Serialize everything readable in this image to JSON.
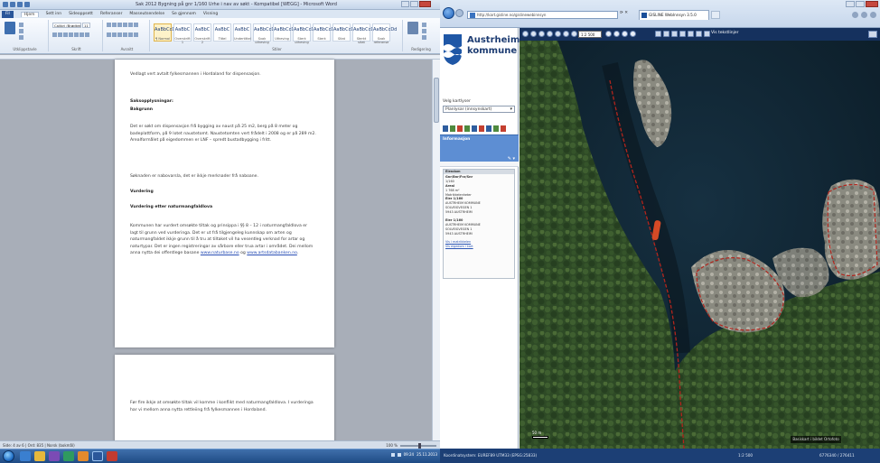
{
  "word": {
    "title": "Sak 2012 Bygning på gnr 1/160 Urhe i nav av søkt - Kompatibel [WEGG] - Microsoft Word",
    "ribbon_tabs": [
      "Fil",
      "Hjem",
      "Sett inn",
      "Sideoppsett",
      "Referanser",
      "Masseutsendelse",
      "Se gjennom",
      "Visning"
    ],
    "file_tab": "Fil",
    "active_tab": "Hjem",
    "font_name": "Calibri (Brødtekst)",
    "font_size": "11",
    "styles": [
      {
        "sample": "AaBbCcDd",
        "name": "¶ Normal"
      },
      {
        "sample": "AaBbC",
        "name": "Overskrift 1"
      },
      {
        "sample": "AaBbC",
        "name": "Overskrift 2"
      },
      {
        "sample": "AaBbC",
        "name": "Tittel"
      },
      {
        "sample": "AaBbC",
        "name": "Undertittel"
      },
      {
        "sample": "AaBbCcDd",
        "name": "Svak utheving"
      },
      {
        "sample": "AaBbCcDd",
        "name": "Utheving"
      },
      {
        "sample": "AaBbCcDd",
        "name": "Sterk utheving"
      },
      {
        "sample": "AaBbCcDd",
        "name": "Sterk"
      },
      {
        "sample": "AaBbCcDd",
        "name": "Sitat"
      },
      {
        "sample": "AaBbCcDd",
        "name": "Sterkt sitat"
      },
      {
        "sample": "AaBbCcDd",
        "name": "Svak referanse"
      }
    ],
    "group_labels": [
      "Utklippstavle",
      "Skrift",
      "Avsnitt",
      "Stiler",
      "Redigering"
    ],
    "page1": {
      "line1": "Vedlagt vert avtalt fylkesmannen i Hordaland for dispensasjon.",
      "h1": "Saksopplysningar:",
      "h2": "Bakgrunn",
      "p1": "Det er søkt om dispensasjon frå bygging av naust på 25 m2, berg på 8 meter og badeplattform, på 9 lotet naustetomt. Naustetomten vert frådelt i 2008 og er på 289 m2. Arealformålet på eigedommen er LNF – spredt bustadbygging i fritt.",
      "p2": "Søknaden er nabovarsla, det er ikkje merknader frå naboane.",
      "h3": "Vurdering",
      "h4": "Vurdering etter naturmangfaldlova",
      "p3": "Kommunen har vurdert omsøkte tiltak og prinsippa i §§ 8 – 12 i naturmangfaldlova er lagt til grunn ved vurderinga. Det er ut frå tilgjengeleg kunnskap om arten og naturmangfaldet ikkje grunn til å tru at tiltaket vil ha vesentleg verknad for artar og naturtypar. Det er ingen registreringar av sårbare eller trua artar i området. Dei mellom anna nytta dei offentlege basane ",
      "link1": "www.naturbase.no",
      "and": " og ",
      "link2": "www.artsdatabanken.no",
      "end": "."
    },
    "page2": {
      "p1": "Før fire ikkje at omsøkte tiltak vil komme i konflikt med naturmangfaldlova. I vurderinga har vi mellom anna nytta rettleiing frå fylkesmannen i Hordaland."
    },
    "status_left": "Side: 4 av 6   |   Ord: 835   |   Norsk (bokmål)",
    "zoom": "100 %"
  },
  "browser": {
    "address": "http://kart.gisline.no/gislinewebinnsyn",
    "tab_title": "GISLINE WebInnsyn 3.5.0",
    "logo_text": "Austrheim\nkommune",
    "panel": {
      "choose_label": "Velg kartlyser",
      "choose_value": "Planlysar (innsynskart)",
      "section_title": "Informasjon",
      "info_header": "Eiendom",
      "info_lines": [
        "Gnr/Bnr/Fnr/Snr",
        "1/160",
        "Areal",
        "1 768 m²",
        "Matrikkelenheter",
        "Eier 1/160",
        "AUSTRHEIM KOMMUNE",
        "SOLVEIGVEGEN 1",
        "5943 AUSTRHEIM",
        "",
        "Eier 1/160",
        "AUSTRHEIM KOMMUNE",
        "SOLVEIGVEGEN 1",
        "5943 AUSTRHEIM"
      ],
      "info_links": [
        "Vis i matrikkelen",
        "Vis eigedom i kart"
      ]
    },
    "map": {
      "scale_value": "1:2 500",
      "layer_label": "Vis tekstlinjer",
      "scale_bar": "50 m",
      "chip": "Basiskart  i bildet  Ortofoto"
    },
    "status": {
      "left": "Koordinatsystem: EUREF89 UTM33 (EPSG:25833)",
      "mid": "1:2 500",
      "right": "6776340 / 276411"
    }
  },
  "taskbar": {
    "clock": "09:24",
    "date": "25.11.2013"
  }
}
